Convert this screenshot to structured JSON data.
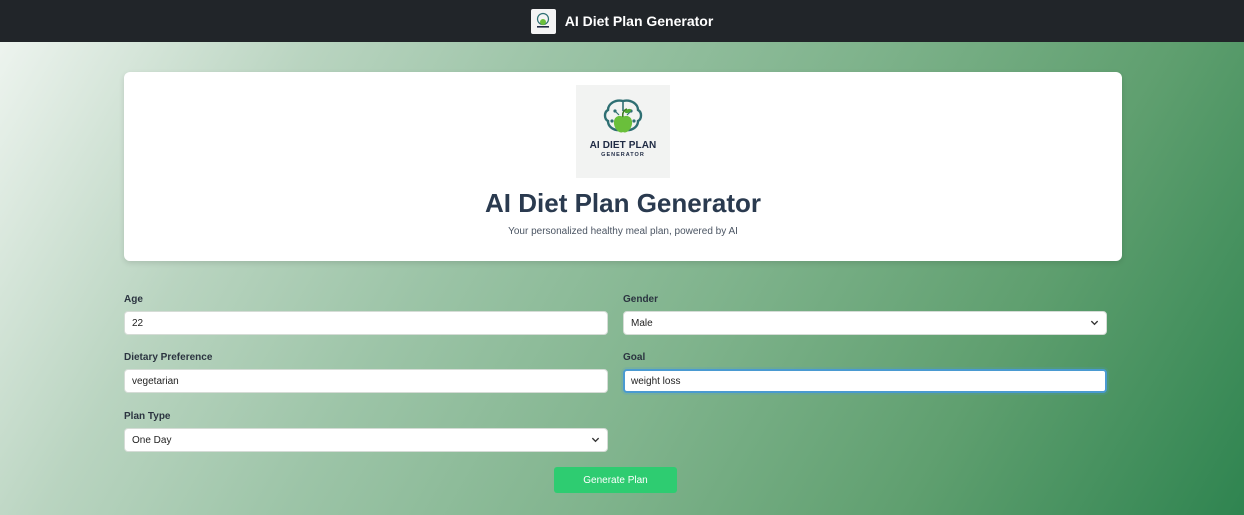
{
  "navbar": {
    "title": "AI Diet Plan Generator",
    "logo_icon": "brain-apple-logo-icon"
  },
  "hero": {
    "logo_line1": "AI DIET PLAN",
    "logo_line2": "GENERATOR",
    "title": "AI Diet Plan Generator",
    "subtitle": "Your personalized healthy meal plan, powered by AI"
  },
  "form": {
    "age": {
      "label": "Age",
      "value": "22"
    },
    "gender": {
      "label": "Gender",
      "value": "Male"
    },
    "dietary_preference": {
      "label": "Dietary Preference",
      "value": "vegetarian"
    },
    "goal": {
      "label": "Goal",
      "value": "weight loss"
    },
    "plan_type": {
      "label": "Plan Type",
      "value": "One Day"
    },
    "submit_label": "Generate Plan"
  },
  "colors": {
    "navbar_bg": "#212529",
    "button_bg": "#2ecc71",
    "title_text": "#2a3a4f",
    "focus_border": "#4a9ad1"
  }
}
